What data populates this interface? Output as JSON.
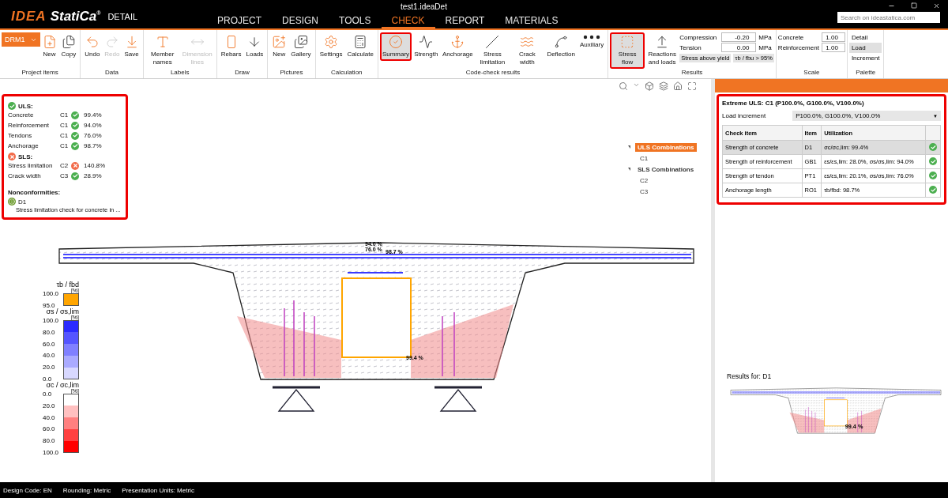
{
  "window": {
    "title": "test1.ideaDet",
    "logo_mark": "IDEA",
    "logo_text": "StatiCa",
    "registered": "®",
    "product": "DETAIL",
    "search_placeholder": "Search on ideastatica.com"
  },
  "menu": [
    {
      "label": "PROJECT",
      "selected": false
    },
    {
      "label": "DESIGN",
      "selected": false
    },
    {
      "label": "TOOLS",
      "selected": false
    },
    {
      "label": "CHECK",
      "selected": true
    },
    {
      "label": "REPORT",
      "selected": false
    },
    {
      "label": "MATERIALS",
      "selected": false
    }
  ],
  "ribbon": {
    "selector": "DRM1",
    "groups": [
      {
        "kind": "buttons",
        "label": "Project items",
        "buttons": [
          {
            "label": "New",
            "disabled": false,
            "selected": false,
            "highlighted": false
          },
          {
            "label": "Copy",
            "disabled": false,
            "selected": false,
            "highlighted": false
          }
        ]
      },
      {
        "kind": "buttons",
        "label": "Data",
        "buttons": [
          {
            "label": "Undo",
            "disabled": false,
            "selected": false,
            "highlighted": false
          },
          {
            "label": "Redo",
            "disabled": true,
            "selected": false,
            "highlighted": false
          },
          {
            "label": "Save",
            "disabled": false,
            "selected": false,
            "highlighted": false
          }
        ]
      },
      {
        "kind": "buttons",
        "label": "Labels",
        "buttons": [
          {
            "label": "Member names",
            "disabled": false,
            "selected": false,
            "highlighted": false
          },
          {
            "label": "Dimension lines",
            "disabled": true,
            "selected": false,
            "highlighted": false
          }
        ]
      },
      {
        "kind": "buttons",
        "label": "Draw",
        "buttons": [
          {
            "label": "Rebars",
            "disabled": false,
            "selected": false,
            "highlighted": false
          },
          {
            "label": "Loads",
            "disabled": false,
            "selected": false,
            "highlighted": false
          }
        ]
      },
      {
        "kind": "buttons",
        "label": "Pictures",
        "buttons": [
          {
            "label": "New",
            "disabled": false,
            "selected": false,
            "highlighted": false
          },
          {
            "label": "Gallery",
            "disabled": false,
            "selected": false,
            "highlighted": false
          }
        ]
      },
      {
        "kind": "buttons",
        "label": "Calculation",
        "buttons": [
          {
            "label": "Settings",
            "disabled": false,
            "selected": false,
            "highlighted": false
          },
          {
            "label": "Calculate",
            "disabled": false,
            "selected": false,
            "highlighted": false
          }
        ]
      },
      {
        "kind": "buttons",
        "label": "Code-check results",
        "buttons": [
          {
            "label": "Summary",
            "disabled": false,
            "selected": true,
            "highlighted": true
          },
          {
            "label": "Strength",
            "disabled": false,
            "selected": false,
            "highlighted": false
          },
          {
            "label": "Anchorage",
            "disabled": false,
            "selected": false,
            "highlighted": false
          },
          {
            "label": "Stress limitation",
            "disabled": false,
            "selected": false,
            "highlighted": false
          },
          {
            "label": "Crack width",
            "disabled": false,
            "selected": false,
            "highlighted": false
          },
          {
            "label": "Deflection",
            "disabled": false,
            "selected": false,
            "highlighted": false
          },
          {
            "label": "Auxiliary",
            "disabled": false,
            "selected": false,
            "highlighted": false
          }
        ]
      },
      {
        "kind": "results",
        "label": "Results",
        "buttons": [
          {
            "label": "Stress flow",
            "disabled": false,
            "selected": true,
            "highlighted": true
          },
          {
            "label": "Reactions and loads",
            "disabled": false,
            "selected": false,
            "highlighted": false
          }
        ],
        "fields": [
          {
            "label": "Compression",
            "value": "-0.20",
            "unit": "MPa"
          },
          {
            "label": "Tension",
            "value": "0.00",
            "unit": "MPa"
          }
        ],
        "flags": [
          "Stress above yield",
          "τb / fbu > 95%"
        ]
      },
      {
        "kind": "scale",
        "label": "Scale",
        "fields": [
          {
            "label": "Concrete",
            "value": "1.00"
          },
          {
            "label": "Reinforcement",
            "value": "1.00"
          }
        ]
      },
      {
        "kind": "palette",
        "label": "Palette",
        "options": [
          {
            "label": "Detail",
            "selected": false
          },
          {
            "label": "Load",
            "selected": true
          },
          {
            "label": "Increment",
            "selected": false
          }
        ]
      }
    ]
  },
  "summary": {
    "highlighted": true,
    "sections": [
      {
        "label": "ULS:",
        "passed": true,
        "rows": [
          {
            "name": "Concrete",
            "combination": "C1",
            "passed": true,
            "value": "99.4%"
          },
          {
            "name": "Reinforcement",
            "combination": "C1",
            "passed": true,
            "value": "94.0%"
          },
          {
            "name": "Tendons",
            "combination": "C1",
            "passed": true,
            "value": "76.0%"
          },
          {
            "name": "Anchorage",
            "combination": "C1",
            "passed": true,
            "value": "98.7%"
          }
        ]
      },
      {
        "label": "SLS:",
        "passed": false,
        "rows": [
          {
            "name": "Stress limitation",
            "combination": "C2",
            "passed": false,
            "value": "140.8%"
          },
          {
            "name": "Crack width",
            "combination": "C3",
            "passed": true,
            "value": "28.9%"
          }
        ]
      }
    ],
    "nonconformities": {
      "title": "Nonconformities:",
      "items": [
        {
          "item": "D1",
          "text": "Stress limitation check for concrete in ..."
        }
      ]
    }
  },
  "tree": [
    {
      "label": "ULS Combinations",
      "selected": true,
      "expanded": true,
      "children": [
        {
          "label": "C1",
          "selected": false
        }
      ]
    },
    {
      "label": "SLS Combinations",
      "selected": false,
      "expanded": true,
      "children": [
        {
          "label": "C2",
          "selected": false
        },
        {
          "label": "C3",
          "selected": false
        }
      ]
    }
  ],
  "legend": [
    {
      "title": "τb / fbd",
      "unit": "[%]",
      "ticks": [
        "100.0",
        "95.0"
      ],
      "segments": [
        {
          "color": "#ffa500"
        }
      ]
    },
    {
      "title": "σs / σs,lim",
      "unit": "[%]",
      "ticks": [
        "100.0",
        "80.0",
        "60.0",
        "40.0",
        "20.0",
        "0.0"
      ],
      "segments": [
        {
          "color": "#2b2bff"
        },
        {
          "color": "#5555ff"
        },
        {
          "color": "#8080ff"
        },
        {
          "color": "#aaaaff"
        },
        {
          "color": "#d8d8ff"
        }
      ]
    },
    {
      "title": "σc / σc,lim",
      "unit": "[%]",
      "ticks": [
        "0.0",
        "20.0",
        "40.0",
        "60.0",
        "80.0",
        "100.0"
      ],
      "segments": [
        {
          "color": "#ffffff"
        },
        {
          "color": "#ffc0c0"
        },
        {
          "color": "#ff8080"
        },
        {
          "color": "#ff4040"
        },
        {
          "color": "#ff0000"
        }
      ]
    }
  ],
  "drawing": {
    "labels": [
      "94.0 %",
      "76.0 %",
      "98.7 %",
      "99.4 %"
    ]
  },
  "results": {
    "highlighted": true,
    "title": "Extreme ULS: C1 (P100.0%, G100.0%, V100.0%)",
    "load_increment": {
      "label": "Load increment",
      "value": "P100.0%, G100.0%, V100.0%",
      "glyph": "▼"
    },
    "columns": [
      "Check item",
      "Item",
      "Utilization"
    ],
    "rows": [
      {
        "check_item": "Strength of concrete",
        "item": "D1",
        "utilization": "σc/σc,lim: 99.4%",
        "passed": true,
        "selected": true
      },
      {
        "check_item": "Strength of reinforcement",
        "item": "GB1",
        "utilization": "εs/εs,lim: 28.0%, σs/σs,lim: 94.0%",
        "passed": true,
        "selected": false
      },
      {
        "check_item": "Strength of tendon",
        "item": "PT1",
        "utilization": "εs/εs,lim: 20.1%, σs/σs,lim: 76.0%",
        "passed": true,
        "selected": false
      },
      {
        "check_item": "Anchorage length",
        "item": "RO1",
        "utilization": "τb/fbd: 98.7%",
        "passed": true,
        "selected": false
      }
    ]
  },
  "preview": {
    "title": "Results for: D1",
    "label": "99.4 %"
  },
  "status_bar": [
    "Design Code: EN",
    "Rounding: Metric",
    "Presentation Units: Metric"
  ]
}
